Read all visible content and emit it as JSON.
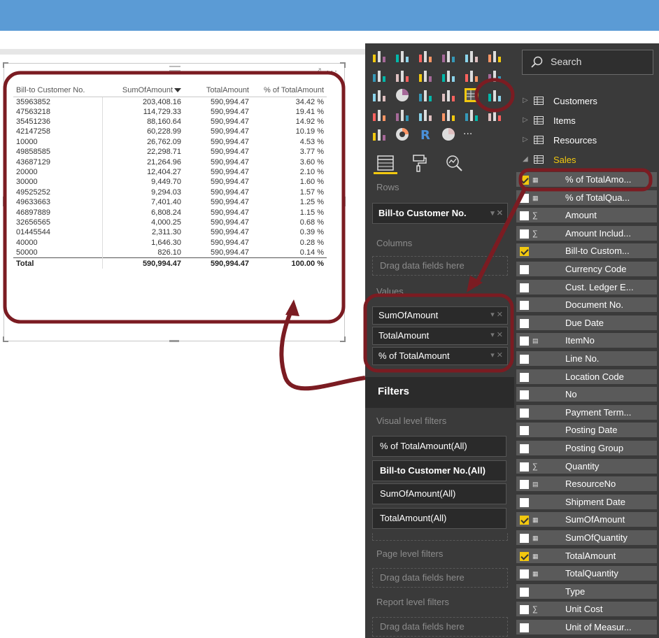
{
  "table": {
    "headers": [
      "Bill-to Customer No.",
      "SumOfAmount",
      "TotalAmount",
      "% of TotalAmount"
    ],
    "rows": [
      [
        "35963852",
        "203,408.16",
        "590,994.47",
        "34.42 %"
      ],
      [
        "47563218",
        "114,729.33",
        "590,994.47",
        "19.41 %"
      ],
      [
        "35451236",
        "88,160.64",
        "590,994.47",
        "14.92 %"
      ],
      [
        "42147258",
        "60,228.99",
        "590,994.47",
        "10.19 %"
      ],
      [
        "10000",
        "26,762.09",
        "590,994.47",
        "4.53 %"
      ],
      [
        "49858585",
        "22,298.71",
        "590,994.47",
        "3.77 %"
      ],
      [
        "43687129",
        "21,264.96",
        "590,994.47",
        "3.60 %"
      ],
      [
        "20000",
        "12,404.27",
        "590,994.47",
        "2.10 %"
      ],
      [
        "30000",
        "9,449.70",
        "590,994.47",
        "1.60 %"
      ],
      [
        "49525252",
        "9,294.03",
        "590,994.47",
        "1.57 %"
      ],
      [
        "49633663",
        "7,401.40",
        "590,994.47",
        "1.25 %"
      ],
      [
        "46897889",
        "6,808.24",
        "590,994.47",
        "1.15 %"
      ],
      [
        "32656565",
        "4,000.25",
        "590,994.47",
        "0.68 %"
      ],
      [
        "01445544",
        "2,311.30",
        "590,994.47",
        "0.39 %"
      ],
      [
        "40000",
        "1,646.30",
        "590,994.47",
        "0.28 %"
      ],
      [
        "50000",
        "826.10",
        "590,994.47",
        "0.14 %"
      ]
    ],
    "total": [
      "Total",
      "590,994.47",
      "590,994.47",
      "100.00 %"
    ],
    "visual_tools": "⤢ ···"
  },
  "viz_pane": {
    "rows_label": "Rows",
    "rows_field": "Bill-to Customer No.",
    "columns_label": "Columns",
    "columns_drop": "Drag data fields here",
    "values_label": "Values",
    "values_fields": [
      "SumOfAmount",
      "TotalAmount",
      "% of TotalAmount"
    ],
    "pill_controls": "▾ ✕",
    "filters_title": "Filters",
    "visual_filters_label": "Visual level filters",
    "visual_filters": [
      "% of TotalAmount(All)",
      "Bill-to Customer No.(All)",
      "SumOfAmount(All)",
      "TotalAmount(All)"
    ],
    "page_filters_label": "Page level filters",
    "page_filters_drop": "Drag data fields here",
    "report_filters_label": "Report level filters",
    "report_filters_drop": "Drag data fields here",
    "more_visuals": "···"
  },
  "fields_pane": {
    "search_placeholder": "Search",
    "tables": [
      "Customers",
      "Items",
      "Resources",
      "Sales"
    ],
    "sales_fields": [
      {
        "name": "% of TotalAmo...",
        "checked": true,
        "icon": "calc-icon"
      },
      {
        "name": "% of TotalQua...",
        "checked": false,
        "icon": "calc-icon"
      },
      {
        "name": "Amount",
        "checked": false,
        "icon": "sigma-icon"
      },
      {
        "name": "Amount Includ...",
        "checked": false,
        "icon": "sigma-icon"
      },
      {
        "name": "Bill-to Custom...",
        "checked": true,
        "icon": ""
      },
      {
        "name": "Currency Code",
        "checked": false,
        "icon": ""
      },
      {
        "name": "Cust. Ledger E...",
        "checked": false,
        "icon": ""
      },
      {
        "name": "Document No.",
        "checked": false,
        "icon": ""
      },
      {
        "name": "Due Date",
        "checked": false,
        "icon": ""
      },
      {
        "name": "ItemNo",
        "checked": false,
        "icon": "hierarchy-icon"
      },
      {
        "name": "Line No.",
        "checked": false,
        "icon": ""
      },
      {
        "name": "Location Code",
        "checked": false,
        "icon": ""
      },
      {
        "name": "No",
        "checked": false,
        "icon": ""
      },
      {
        "name": "Payment Term...",
        "checked": false,
        "icon": ""
      },
      {
        "name": "Posting Date",
        "checked": false,
        "icon": ""
      },
      {
        "name": "Posting Group",
        "checked": false,
        "icon": ""
      },
      {
        "name": "Quantity",
        "checked": false,
        "icon": "sigma-icon"
      },
      {
        "name": "ResourceNo",
        "checked": false,
        "icon": "hierarchy-icon"
      },
      {
        "name": "Shipment Date",
        "checked": false,
        "icon": ""
      },
      {
        "name": "SumOfAmount",
        "checked": true,
        "icon": "calc-icon"
      },
      {
        "name": "SumOfQuantity",
        "checked": false,
        "icon": "calc-icon"
      },
      {
        "name": "TotalAmount",
        "checked": true,
        "icon": "calc-icon"
      },
      {
        "name": "TotalQuantity",
        "checked": false,
        "icon": "calc-icon"
      },
      {
        "name": "Type",
        "checked": false,
        "icon": ""
      },
      {
        "name": "Unit Cost",
        "checked": false,
        "icon": "sigma-icon"
      },
      {
        "name": "Unit of Measur...",
        "checked": false,
        "icon": ""
      }
    ]
  },
  "colors": {
    "header_blue": "#5b9bd5",
    "pane_dark": "#3a3a3a",
    "accent_yellow": "#f2c80f",
    "annotation_red": "#7b1c22"
  }
}
